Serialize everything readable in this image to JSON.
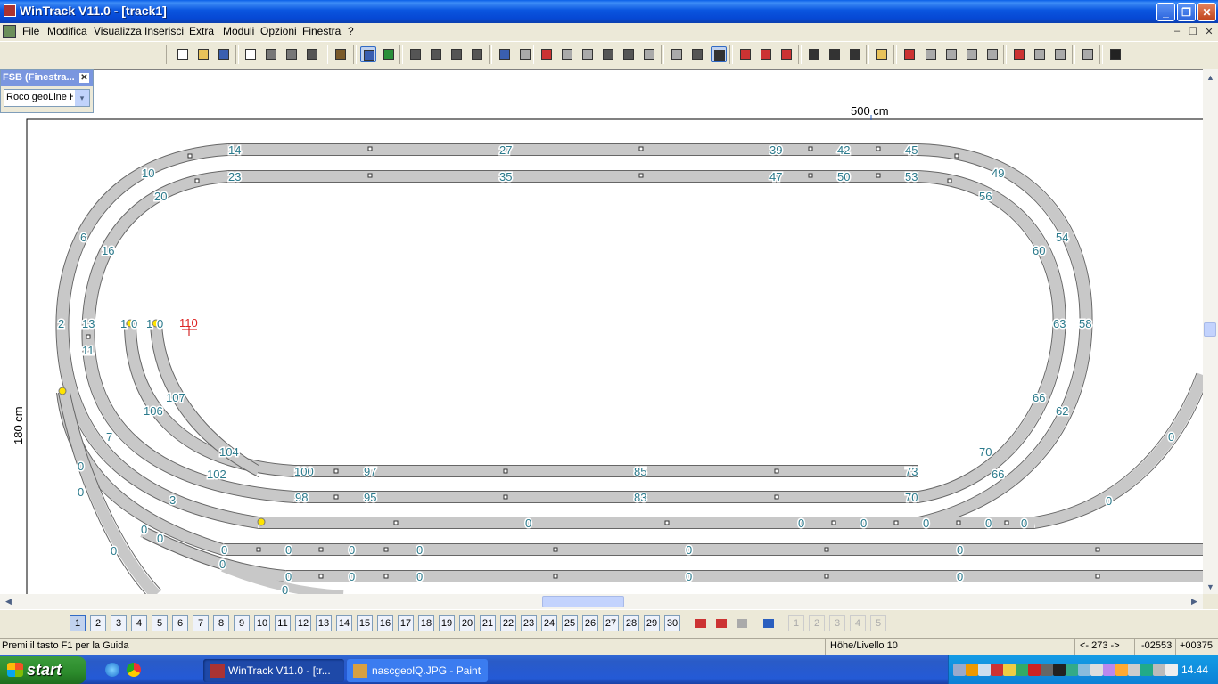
{
  "window": {
    "title": "WinTrack  V11.0 - [track1]",
    "controls": {
      "minimize": "_",
      "maximize": "❐",
      "close": "✕"
    }
  },
  "menu": {
    "items": [
      "File",
      "Modifica",
      "Visualizza",
      "Inserisci",
      "Extra",
      "Moduli",
      "Opzioni",
      "Finestra",
      "?"
    ],
    "mdi_controls": [
      "–",
      "❐",
      "✕"
    ]
  },
  "toolbar": {
    "icons": [
      "new-icon",
      "open-icon",
      "save-icon",
      "print-preview-icon",
      "print-icon",
      "print-setup-icon",
      "page-icon",
      "library-icon",
      "layer-settings-icon",
      "landscape-icon",
      "zoom-out-icon",
      "zoom-in-icon",
      "zoom-window-icon",
      "zoom-all-icon",
      "undo-icon",
      "redo-icon",
      "delete-icon",
      "copy-block-icon",
      "paste-block-icon",
      "cut-icon",
      "copy-icon",
      "paste-icon",
      "turnout-icon",
      "curve-icon",
      "flex-track-icon",
      "section-icon",
      "layer-red-icon",
      "layer-red-alt-icon",
      "cross-icon",
      "rotate-icon",
      "rotate-180-icon",
      "height-icon",
      "signal-icon",
      "gradient-icon",
      "track-join-icon",
      "track-split-icon",
      "track-join-alt-icon",
      "measure-icon",
      "level-icon",
      "level-alt-icon",
      "grid-icon",
      "context-help-icon"
    ]
  },
  "fsb": {
    "title": "FSB (Finestra...",
    "close": "✕",
    "selected": "Roco geoLine H",
    "arrow": "▾"
  },
  "drawing": {
    "top_dimension": "500 cm",
    "side_dimension": "180 cm",
    "highlight_label": "110",
    "accent_color": "#2a8f9a",
    "track_fill": "#c8c8c8",
    "label_color": "#2b7a8c"
  },
  "scrollbars": {
    "up": "▲",
    "down": "▼",
    "left": "◀",
    "right": "▶"
  },
  "layers": {
    "labels": [
      "1",
      "2",
      "3",
      "4",
      "5",
      "6",
      "7",
      "8",
      "9",
      "10",
      "11",
      "12",
      "13",
      "14",
      "15",
      "16",
      "17",
      "18",
      "19",
      "20",
      "21",
      "22",
      "23",
      "24",
      "25",
      "26",
      "27",
      "28",
      "29",
      "30"
    ],
    "active": "1",
    "extra": [
      "1",
      "2",
      "3",
      "4",
      "5"
    ]
  },
  "status": {
    "help": "Premi il tasto F1 per la Guida",
    "level": "Höhe/Livello 10",
    "angle": "<- 273 ->",
    "x": "-02553",
    "y": "+00375"
  },
  "taskbar": {
    "start": "start",
    "tasks": [
      "WinTrack  V11.0 - [tr...",
      "nascgeolQ.JPG - Paint"
    ],
    "clock": "14.44"
  },
  "track_labels": [
    "14",
    "27",
    "39",
    "42",
    "45",
    "23",
    "35",
    "47",
    "50",
    "53",
    "10",
    "20",
    "49",
    "56",
    "6",
    "16",
    "60",
    "54",
    "2",
    "13",
    "11",
    "1",
    "0",
    "1",
    "0",
    "110",
    "63",
    "58",
    "107",
    "106",
    "66",
    "62",
    "7",
    "104",
    "70",
    "0",
    "102",
    "100",
    "97",
    "85",
    "73",
    "66",
    "0",
    "0",
    "3",
    "98",
    "95",
    "83",
    "70",
    "0",
    "0",
    "0",
    "0",
    "0",
    "0",
    "0",
    "0",
    "0",
    "0",
    "0",
    "0",
    "0",
    "0",
    "0",
    "0",
    "0",
    "0",
    "0",
    "0",
    "0",
    "0",
    "0"
  ]
}
